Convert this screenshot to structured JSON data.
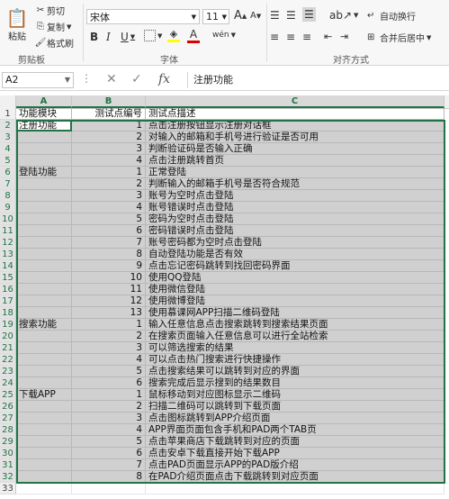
{
  "ribbon": {
    "clipboard": {
      "paste_label": "粘贴",
      "cut_label": "剪切",
      "copy_label": "复制",
      "format_painter_label": "格式刷",
      "group_label": "剪贴板"
    },
    "font": {
      "font_name": "宋体",
      "font_size": "11",
      "grow_label": "A",
      "shrink_label": "A",
      "bold": "B",
      "italic": "I",
      "underline": "U",
      "font_color_label": "A",
      "phonetic_label": "wén",
      "group_label": "字体"
    },
    "alignment": {
      "wrap_text_label": "自动换行",
      "merge_center_label": "合并后居中",
      "group_label": "对齐方式"
    }
  },
  "formula_bar": {
    "name_box": "A2",
    "fx_label": "fx",
    "content": "注册功能"
  },
  "sheet": {
    "columns": [
      "A",
      "B",
      "C"
    ],
    "rows": [
      {
        "num": "1",
        "a": "功能模块",
        "b": "测试点编号",
        "c": "测试点描述"
      },
      {
        "num": "2",
        "a": "注册功能",
        "b": "1",
        "c": "点击注册按钮显示注册对话框"
      },
      {
        "num": "3",
        "a": "",
        "b": "2",
        "c": "对输入的邮箱和手机号进行验证是否可用"
      },
      {
        "num": "4",
        "a": "",
        "b": "3",
        "c": "判断验证码是否输入正确"
      },
      {
        "num": "5",
        "a": "",
        "b": "4",
        "c": "点击注册跳转首页"
      },
      {
        "num": "6",
        "a": "登陆功能",
        "b": "1",
        "c": "正常登陆"
      },
      {
        "num": "7",
        "a": "",
        "b": "2",
        "c": "判断输入的邮箱手机号是否符合规范"
      },
      {
        "num": "8",
        "a": "",
        "b": "3",
        "c": "账号为空时点击登陆"
      },
      {
        "num": "9",
        "a": "",
        "b": "4",
        "c": "账号错误时点击登陆"
      },
      {
        "num": "10",
        "a": "",
        "b": "5",
        "c": "密码为空时点击登陆"
      },
      {
        "num": "11",
        "a": "",
        "b": "6",
        "c": "密码错误时点击登陆"
      },
      {
        "num": "12",
        "a": "",
        "b": "7",
        "c": "账号密码都为空时点击登陆"
      },
      {
        "num": "13",
        "a": "",
        "b": "8",
        "c": "自动登陆功能是否有效"
      },
      {
        "num": "14",
        "a": "",
        "b": "9",
        "c": "点击忘记密码跳转到找回密码界面"
      },
      {
        "num": "15",
        "a": "",
        "b": "10",
        "c": "使用QQ登陆"
      },
      {
        "num": "16",
        "a": "",
        "b": "11",
        "c": "使用微信登陆"
      },
      {
        "num": "17",
        "a": "",
        "b": "12",
        "c": "使用微博登陆"
      },
      {
        "num": "18",
        "a": "",
        "b": "13",
        "c": "使用慕课网APP扫描二维码登陆"
      },
      {
        "num": "19",
        "a": "搜索功能",
        "b": "1",
        "c": "输入任意信息点击搜索跳转到搜索结果页面"
      },
      {
        "num": "20",
        "a": "",
        "b": "2",
        "c": "在搜索页面输入任意信息可以进行全站检索"
      },
      {
        "num": "21",
        "a": "",
        "b": "3",
        "c": "可以筛选搜索的结果"
      },
      {
        "num": "22",
        "a": "",
        "b": "4",
        "c": "可以点击热门搜索进行快捷操作"
      },
      {
        "num": "23",
        "a": "",
        "b": "5",
        "c": "点击搜索结果可以跳转到对应的界面"
      },
      {
        "num": "24",
        "a": "",
        "b": "6",
        "c": "搜索完成后显示搜到的结果数目"
      },
      {
        "num": "25",
        "a": "下载APP",
        "b": "1",
        "c": "鼠标移动到对应图标显示二维码"
      },
      {
        "num": "26",
        "a": "",
        "b": "2",
        "c": "扫描二维码可以跳转到下载页面"
      },
      {
        "num": "27",
        "a": "",
        "b": "3",
        "c": "点击图标跳转到APP介绍页面"
      },
      {
        "num": "28",
        "a": "",
        "b": "4",
        "c": "APP界面页面包含手机和PAD两个TAB页"
      },
      {
        "num": "29",
        "a": "",
        "b": "5",
        "c": "点击苹果商店下载跳转到对应的页面"
      },
      {
        "num": "30",
        "a": "",
        "b": "6",
        "c": "点击安卓下载直接开始下载APP"
      },
      {
        "num": "31",
        "a": "",
        "b": "7",
        "c": "点击PAD页面显示APP的PAD版介绍"
      },
      {
        "num": "32",
        "a": "",
        "b": "8",
        "c": "在PAD介绍页面点击下载跳转到对应页面"
      },
      {
        "num": "33",
        "a": "",
        "b": "",
        "c": ""
      }
    ]
  },
  "colors": {
    "selection": "#217346",
    "cell_fill": "#d0d0d0"
  }
}
